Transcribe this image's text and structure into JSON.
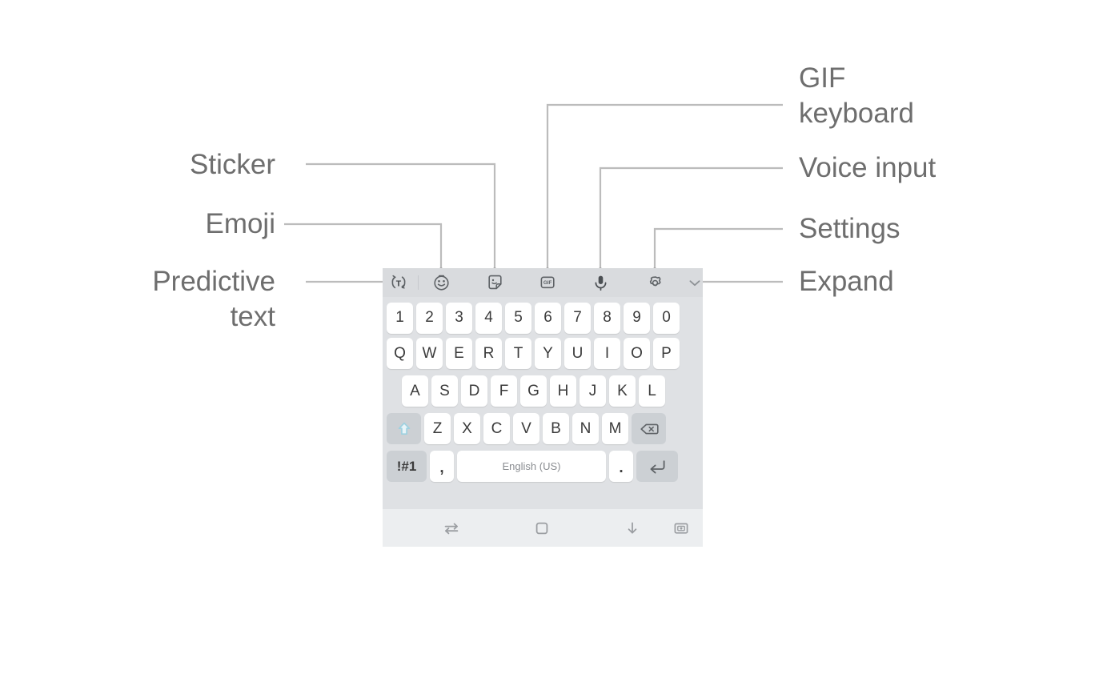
{
  "diagram": {
    "title": "Samsung keyboard annotated callouts",
    "line_color": "#b9b9b9",
    "label_color": "#6e6e6e"
  },
  "callouts": {
    "left": [
      {
        "id": "sticker",
        "label": "Sticker",
        "target_icon": "sticker-icon"
      },
      {
        "id": "emoji",
        "label": "Emoji",
        "target_icon": "emoji-icon"
      },
      {
        "id": "predictive_text",
        "label": "Predictive\ntext",
        "target_icon": "predictive-text-icon"
      }
    ],
    "right": [
      {
        "id": "gif_keyboard",
        "label": "GIF\nkeyboard",
        "target_icon": "gif-icon"
      },
      {
        "id": "voice_input",
        "label": "Voice input",
        "target_icon": "microphone-icon"
      },
      {
        "id": "settings",
        "label": "Settings",
        "target_icon": "gear-icon"
      },
      {
        "id": "expand",
        "label": "Expand",
        "target_icon": "chevron-down-icon"
      }
    ]
  },
  "keyboard": {
    "background": "#dfe1e4",
    "toolbar": {
      "background": "#d9dbde",
      "buttons": [
        {
          "name": "predictive-text-icon",
          "title": "Predictive text"
        },
        {
          "name": "emoji-icon",
          "title": "Emoji"
        },
        {
          "name": "sticker-icon",
          "title": "Sticker"
        },
        {
          "name": "gif-icon",
          "title": "GIF keyboard"
        },
        {
          "name": "microphone-icon",
          "title": "Voice input"
        },
        {
          "name": "gear-icon",
          "title": "Settings"
        },
        {
          "name": "chevron-down-icon",
          "title": "Expand"
        }
      ]
    },
    "rows": {
      "numbers": [
        "1",
        "2",
        "3",
        "4",
        "5",
        "6",
        "7",
        "8",
        "9",
        "0"
      ],
      "top": [
        "Q",
        "W",
        "E",
        "R",
        "T",
        "Y",
        "U",
        "I",
        "O",
        "P"
      ],
      "home": [
        "A",
        "S",
        "D",
        "F",
        "G",
        "H",
        "J",
        "K",
        "L"
      ],
      "bottom": [
        "Z",
        "X",
        "C",
        "V",
        "B",
        "N",
        "M"
      ]
    },
    "special": {
      "shift": {
        "name": "shift-key",
        "icon": "shift-arrow-icon",
        "color": "#9ed1e0"
      },
      "backspace": {
        "name": "backspace-key",
        "icon": "backspace-icon"
      },
      "symbols": {
        "name": "symbols-key",
        "label": "!#1"
      },
      "comma": {
        "name": "comma-key",
        "label": ","
      },
      "space": {
        "name": "space-key",
        "label": "English (US)"
      },
      "period": {
        "name": "period-key",
        "label": "."
      },
      "enter": {
        "name": "enter-key",
        "icon": "enter-arrow-icon"
      }
    }
  },
  "navbar": {
    "background": "#eceef0",
    "buttons": [
      {
        "name": "recents-icon",
        "title": "Recents"
      },
      {
        "name": "home-icon",
        "title": "Home"
      },
      {
        "name": "hide-keyboard-icon",
        "title": "Hide keyboard"
      },
      {
        "name": "keyboard-switch-icon",
        "title": "Switch keyboard"
      }
    ]
  }
}
